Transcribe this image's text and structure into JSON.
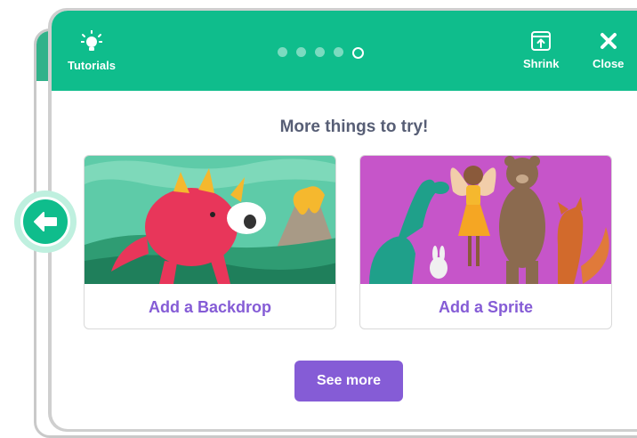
{
  "header": {
    "tutorials_label": "Tutorials",
    "shrink_label": "Shrink",
    "close_label": "Close",
    "steps_total": 5,
    "current_step": 5
  },
  "main": {
    "title": "More things to try!",
    "tiles": [
      {
        "label": "Add a Backdrop",
        "icon": "dinosaur-volcano-illustration"
      },
      {
        "label": "Add a Sprite",
        "icon": "characters-illustration"
      }
    ],
    "see_more_label": "See more"
  },
  "colors": {
    "header_green": "#0fbd8c",
    "accent_purple": "#855cd6",
    "title_gray": "#575e75"
  }
}
